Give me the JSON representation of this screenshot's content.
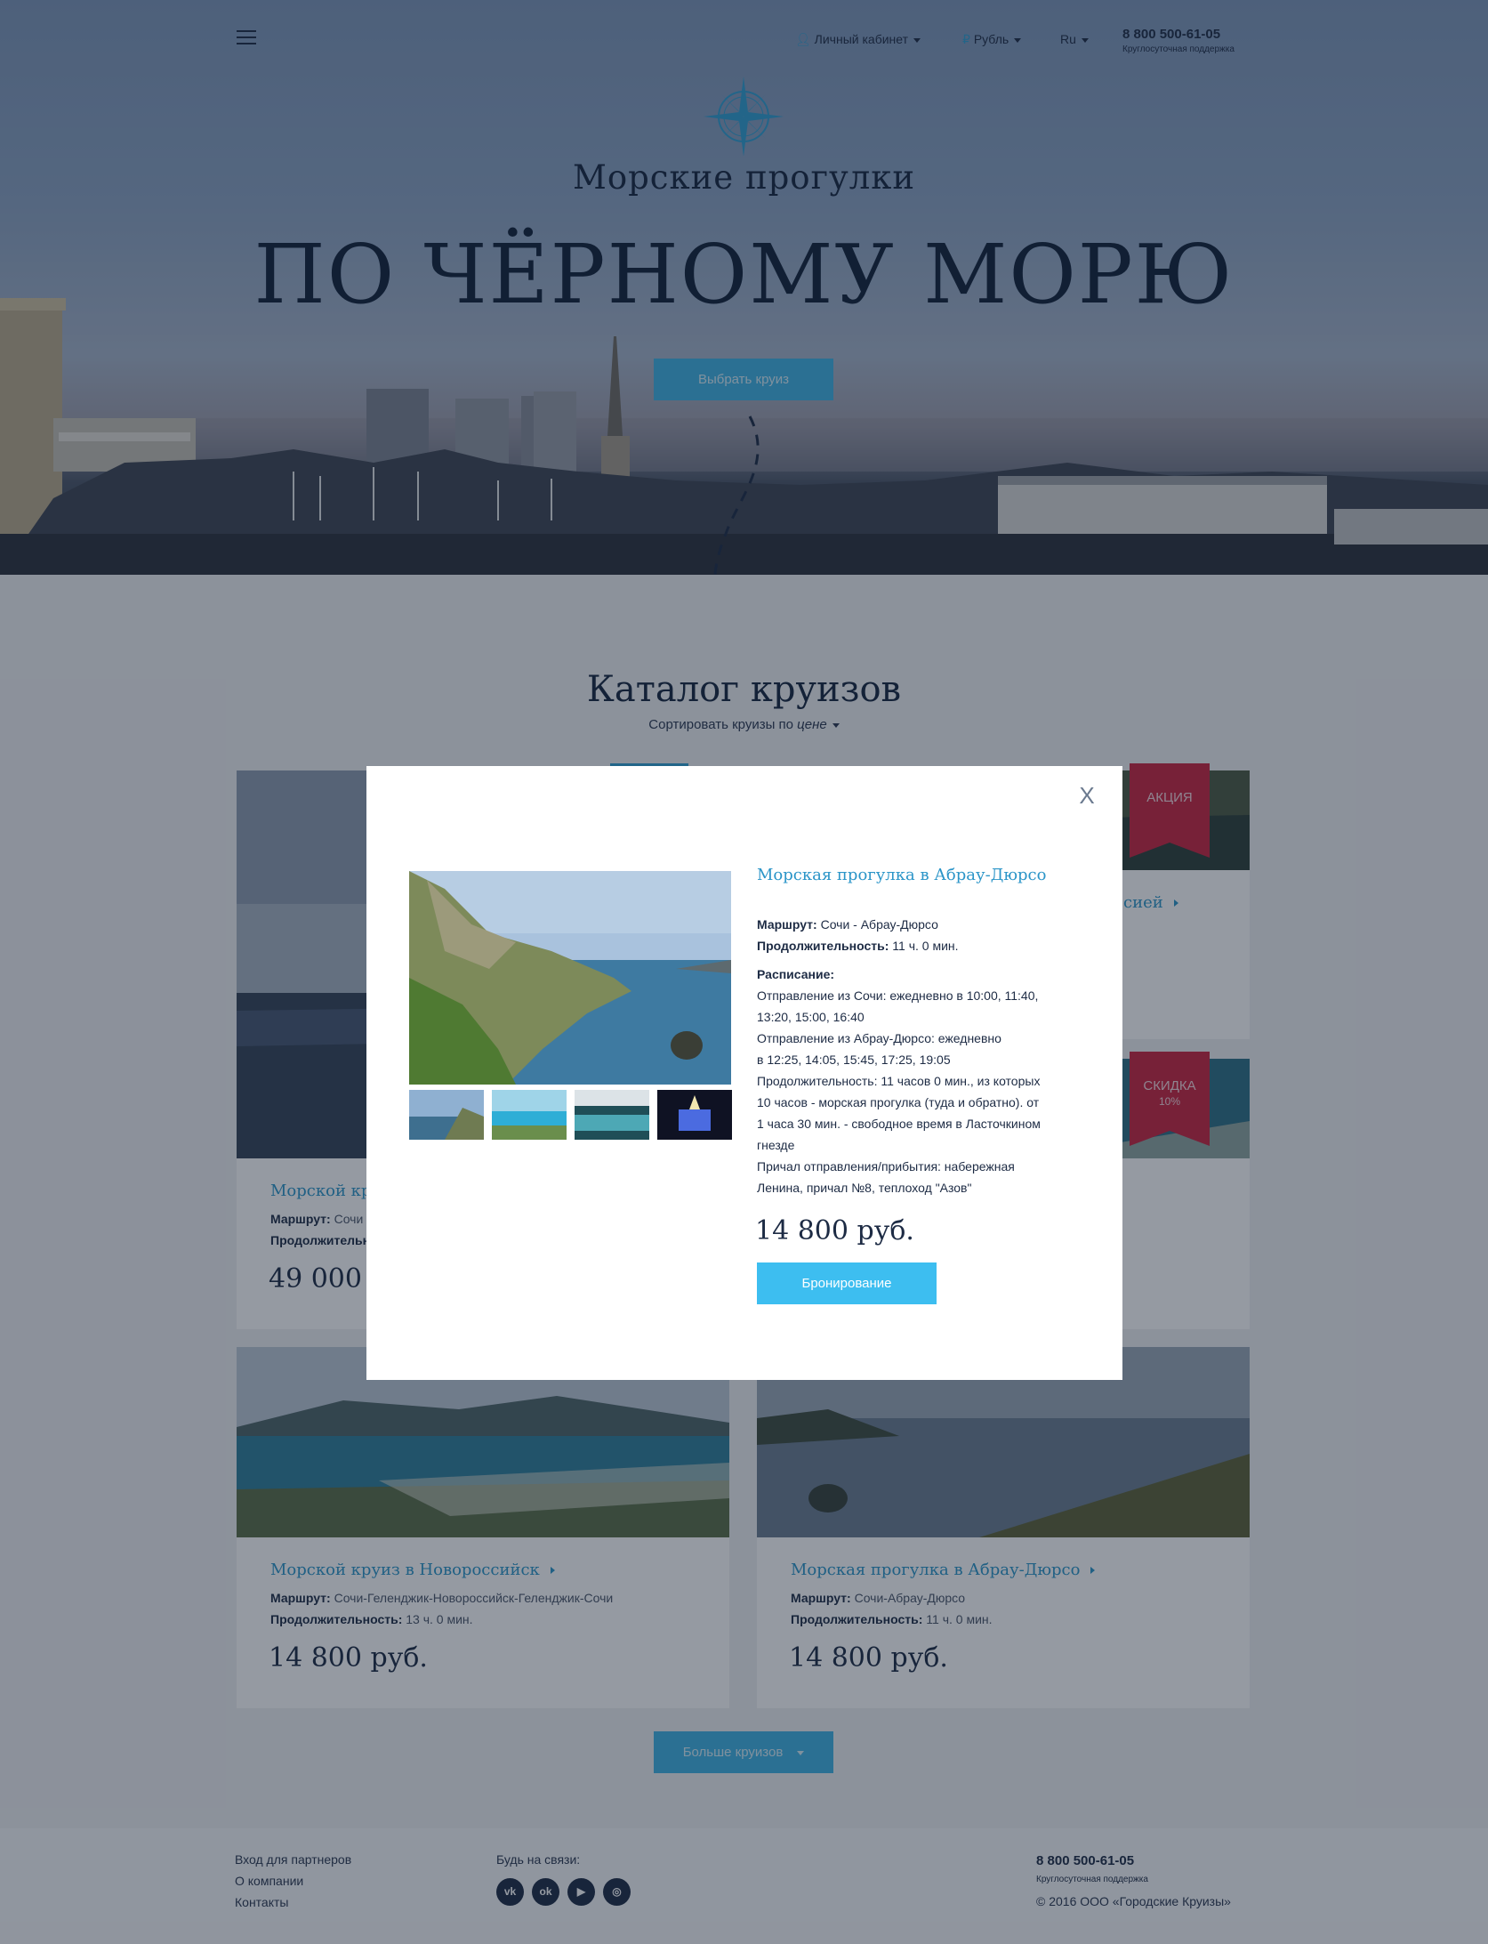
{
  "header": {
    "account_label": "Личный кабинет",
    "currency_label": "Рубль",
    "lang_label": "Ru",
    "phone": "8 800 500-61-05",
    "phone_sub": "Круглосуточная поддержка"
  },
  "hero": {
    "subtitle": "Морские прогулки",
    "title": "ПО ЧЁРНОМУ МОРЮ",
    "cta": "Выбрать круиз"
  },
  "catalog": {
    "title": "Каталог круизов",
    "sort_prefix": "Сортировать круизы по",
    "sort_option": "цене",
    "route_label": "Маршрут:",
    "duration_label": "Продолжительность:",
    "cards": [
      {
        "title": "Морской кр",
        "route": "Сочи",
        "duration": "",
        "price": "49 000"
      },
      {
        "title": "сией",
        "badge": "АКЦИЯ"
      },
      {
        "badge": "СКИДКА",
        "badge_sub": "10%"
      },
      {
        "title": "Морской круиз в Новороссийск",
        "route": "Сочи-Геленджик-Новороссийск-Геленджик-Сочи",
        "duration": "13 ч. 0 мин.",
        "price": "14 800 руб."
      },
      {
        "title": "Морская прогулка в Абрау-Дюрсо",
        "route": "Сочи-Абрау-Дюрсо",
        "duration": "11 ч. 0 мин.",
        "price": "14 800 руб."
      }
    ],
    "more_label": "Больше круизов"
  },
  "modal": {
    "close_label": "X",
    "title": "Морская прогулка в Абрау-Дюрсо",
    "route_label": "Маршрут:",
    "route": "Сочи - Абрау-Дюрсо",
    "duration_label": "Продолжительность:",
    "duration": "11 ч. 0 мин.",
    "schedule_label": "Расписание:",
    "schedule_lines": [
      "Отправление из Сочи: ежедневно в 10:00, 11:40,",
      "13:20, 15:00, 16:40",
      "Отправление из Абрау-Дюрсо: ежедневно",
      "в 12:25, 14:05, 15:45, 17:25, 19:05",
      "Продолжительность: 11 часов 0 мин., из которых",
      "10 часов - морская прогулка (туда и обратно). от",
      "1 часа 30 мин. - свободное время в Ласточкином",
      "гнезде",
      "Причал отправления/прибытия: набережная",
      "Ленина, причал №8, теплоход \"Азов\""
    ],
    "price": "14 800 руб.",
    "book_label": "Бронирование"
  },
  "footer": {
    "links": [
      "Вход для партнеров",
      "О компании",
      "Контакты"
    ],
    "social_label": "Будь на связи:",
    "socials": [
      {
        "icon": "vk-icon",
        "glyph": "vk"
      },
      {
        "icon": "odnoklassniki-icon",
        "glyph": "ok"
      },
      {
        "icon": "youtube-icon",
        "glyph": "▶"
      },
      {
        "icon": "instagram-icon",
        "glyph": "◎"
      }
    ],
    "phone": "8 800 500-61-05",
    "phone_sub": "Круглосуточная поддержка",
    "copyright": "© 2016 ООО «Городские Круизы»"
  },
  "colors": {
    "accent": "#3fb3e3",
    "link": "#2b95c8",
    "ribbon": "#c8233e",
    "dark": "#1d2b44"
  }
}
